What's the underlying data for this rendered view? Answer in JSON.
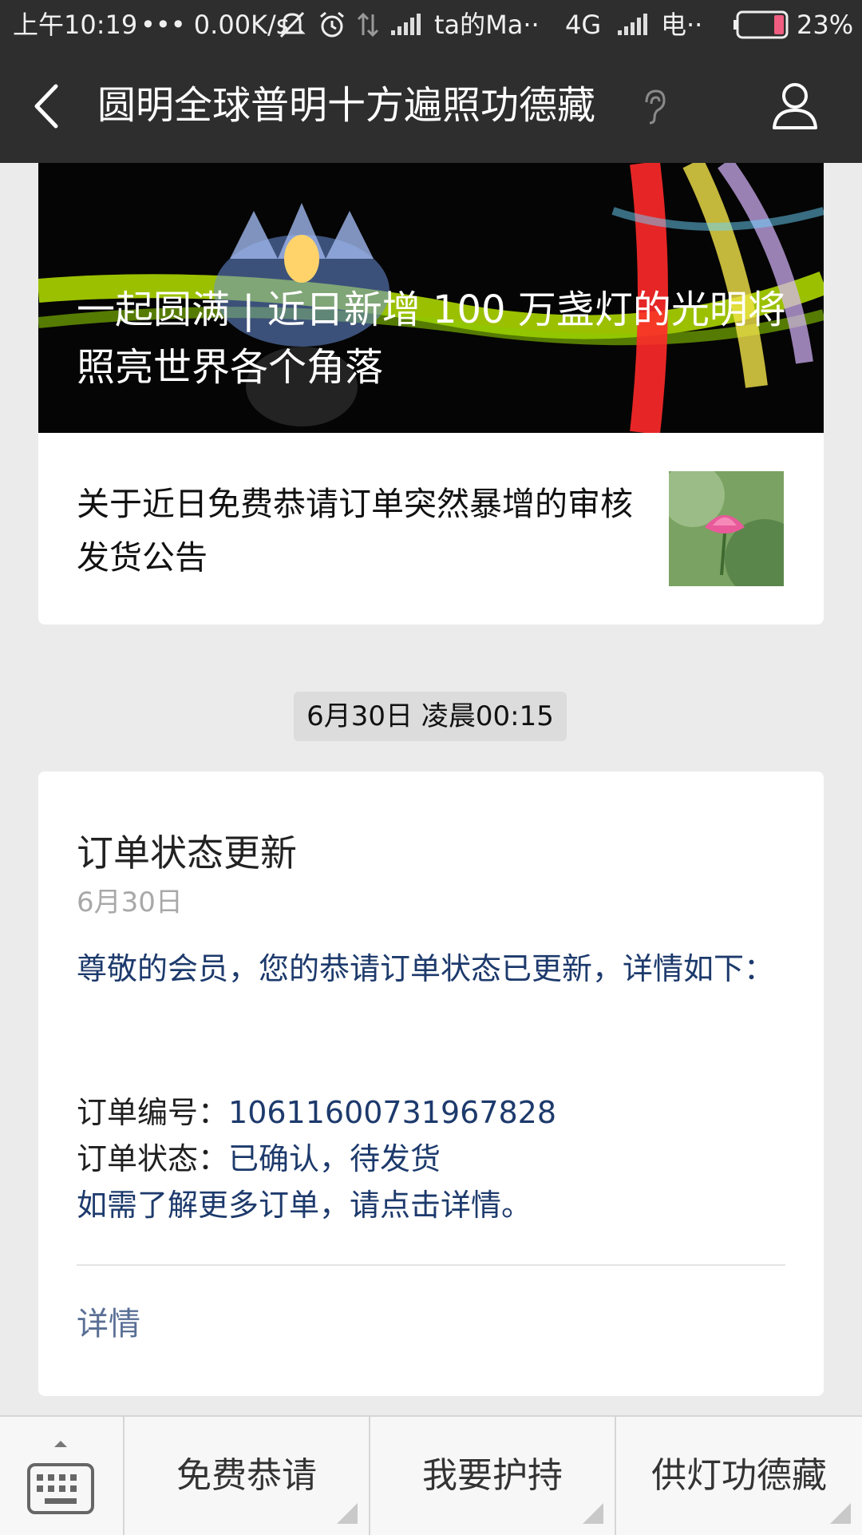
{
  "status_bar": {
    "time": "上午10:19",
    "speed": "••• 0.00K/s",
    "ssid": "ta的Ma··",
    "network": "4G",
    "carrier": "电··",
    "battery": "23%"
  },
  "header": {
    "title": "圆明全球普明十方遍照功德藏"
  },
  "article": {
    "banner_title": "一起圆满 | 近日新增 100 万盏灯的光明将照亮世界各个角落",
    "sub_title": "关于近日免费恭请订单突然暴增的审核发货公告"
  },
  "timestamp": "6月30日 凌晨00:15",
  "notice": {
    "title": "订单状态更新",
    "date": "6月30日",
    "greeting": "尊敬的会员，您的恭请订单状态已更新，详情如下：",
    "order_no_label": "订单编号：",
    "order_no": "10611600731967828",
    "status_label": "订单状态：",
    "status": "已确认，待发货",
    "more": "如需了解更多订单，请点击详情。",
    "details_link": "详情"
  },
  "bottom_menu": {
    "items": [
      "免费恭请",
      "我要护持",
      "供灯功德藏"
    ]
  },
  "colors": {
    "topbar": "#2e2e2e",
    "background": "#ebebeb",
    "link_blue": "#1d3a6c"
  }
}
